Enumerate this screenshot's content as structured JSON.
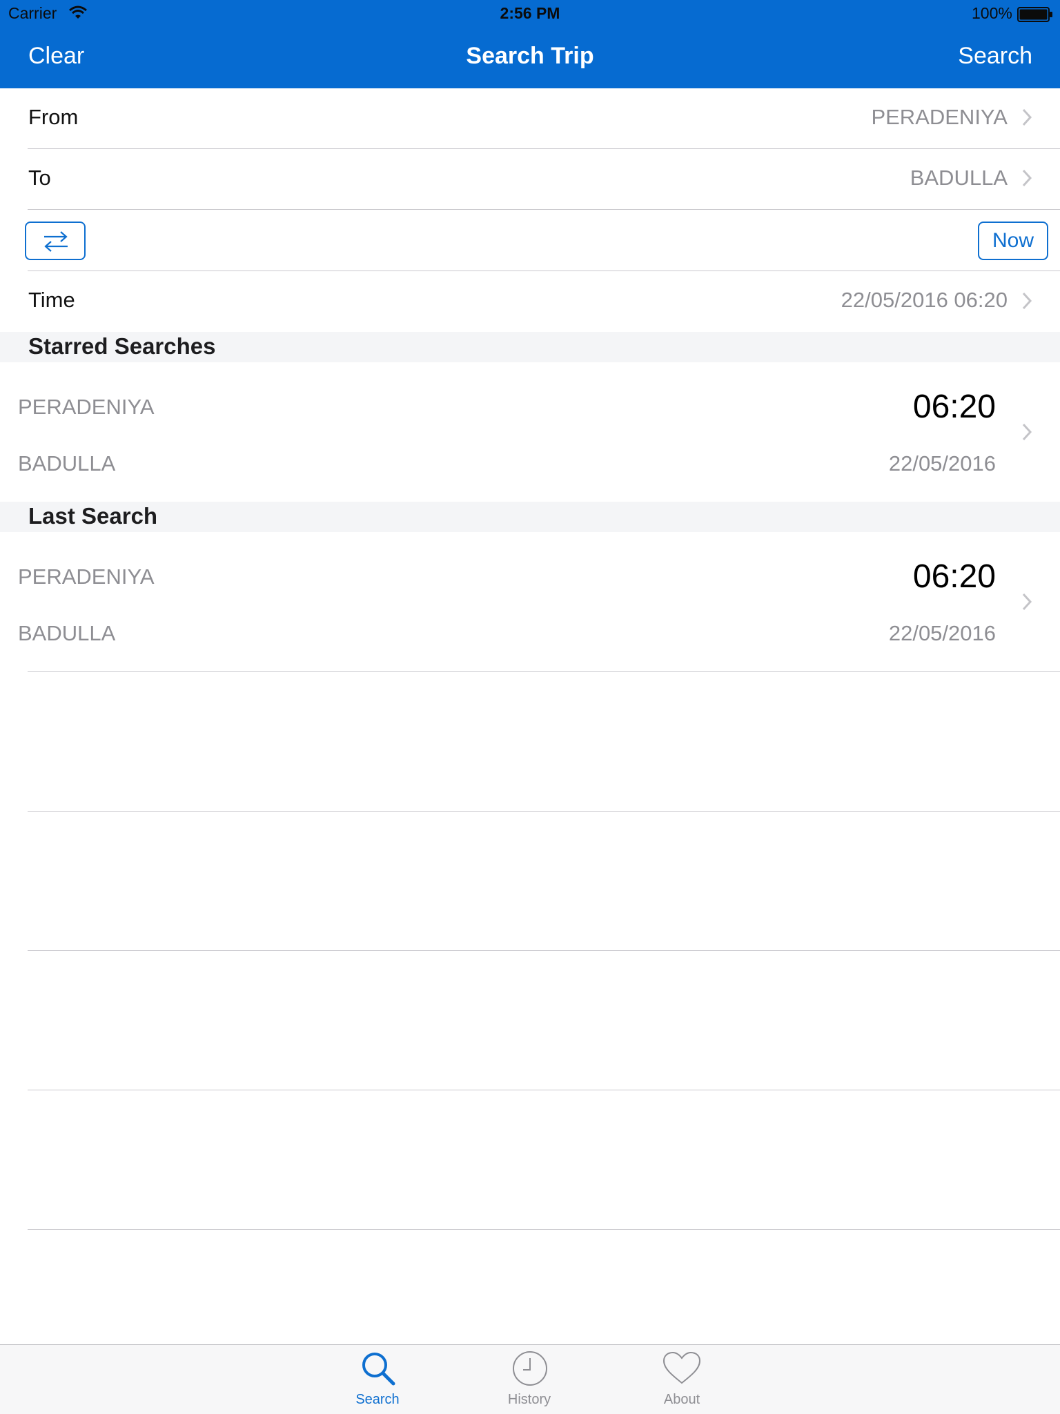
{
  "status_bar": {
    "carrier": "Carrier",
    "time": "2:56 PM",
    "battery": "100%"
  },
  "nav": {
    "title": "Search Trip",
    "left_button": "Clear",
    "right_button": "Search"
  },
  "form": {
    "from_label": "From",
    "from_value": "PERADENIYA",
    "to_label": "To",
    "to_value": "BADULLA",
    "now_button": "Now",
    "time_label": "Time",
    "time_value": "22/05/2016 06:20"
  },
  "starred": {
    "title": "Starred Searches",
    "item": {
      "from": "PERADENIYA",
      "to": "BADULLA",
      "time": "06:20",
      "date": "22/05/2016"
    }
  },
  "last": {
    "title": "Last Search",
    "item": {
      "from": "PERADENIYA",
      "to": "BADULLA",
      "time": "06:20",
      "date": "22/05/2016"
    }
  },
  "tabs": [
    {
      "label": "Search",
      "icon": "search-icon",
      "active": true
    },
    {
      "label": "History",
      "icon": "clock-icon",
      "active": false
    },
    {
      "label": "About",
      "icon": "heart-icon",
      "active": false
    }
  ],
  "colors": {
    "nav_bar": "#066BD1",
    "accent": "#0E6FD0",
    "secondary_text": "#8e8e93"
  }
}
